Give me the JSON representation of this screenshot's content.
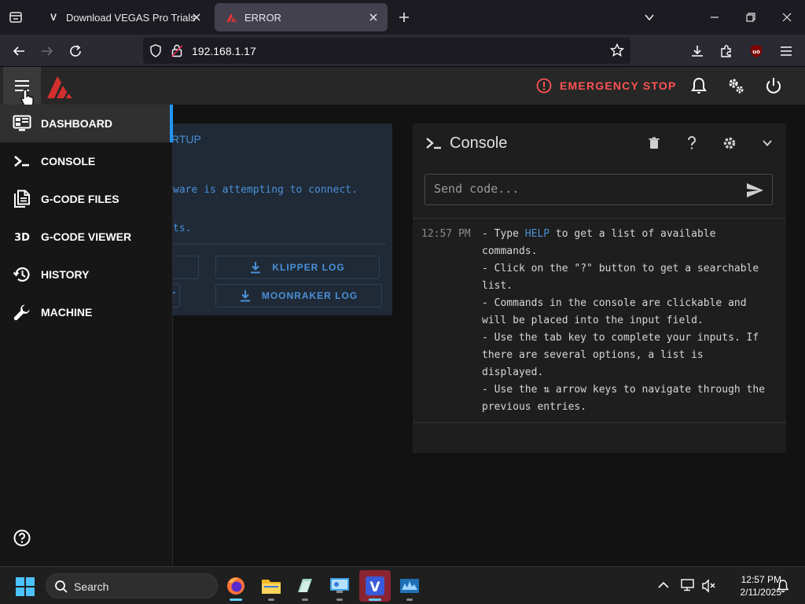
{
  "browser": {
    "tabs": [
      {
        "title": "Download VEGAS Pro Trials for",
        "favicon": "V"
      },
      {
        "title": "ERROR",
        "favicon": "mainsail-logo"
      }
    ],
    "url": "192.168.1.17"
  },
  "app": {
    "emergency_stop": "EMERGENCY STOP",
    "accent_color": "#ff5252"
  },
  "sidebar": {
    "items": [
      {
        "label": "DASHBOARD",
        "icon": "monitor-dashboard-icon"
      },
      {
        "label": "CONSOLE",
        "icon": "console-icon"
      },
      {
        "label": "G-CODE FILES",
        "icon": "files-icon"
      },
      {
        "label": "G-CODE VIEWER",
        "icon": "3d-icon"
      },
      {
        "label": "HISTORY",
        "icon": "history-icon"
      },
      {
        "label": "MACHINE",
        "icon": "wrench-icon"
      }
    ]
  },
  "startup": {
    "header": "RTUP",
    "message": "ware is attempting to connect.",
    "message2": "ts.",
    "klipper_log": "KLIPPER LOG",
    "moonraker_log": "MOONRAKER LOG",
    "left_btn2": "T"
  },
  "console": {
    "title": "Console",
    "input_placeholder": "Send code...",
    "entry_time": "12:57 PM",
    "lines": [
      {
        "pre": "- Type ",
        "kw": "HELP",
        "post": " to get a list of available"
      },
      {
        "pre": "commands.",
        "kw": "",
        "post": ""
      },
      {
        "pre": "- Click on the \"?\" button to get a searchable",
        "kw": "",
        "post": ""
      },
      {
        "pre": "list.",
        "kw": "",
        "post": ""
      },
      {
        "pre": "- Commands in the console are clickable and",
        "kw": "",
        "post": ""
      },
      {
        "pre": "will be placed into the input field.",
        "kw": "",
        "post": ""
      },
      {
        "pre": "- Use the tab key to complete your inputs. If",
        "kw": "",
        "post": ""
      },
      {
        "pre": "there are several options, a list is",
        "kw": "",
        "post": ""
      },
      {
        "pre": "displayed.",
        "kw": "",
        "post": ""
      },
      {
        "pre": "- Use the ⇅ arrow keys to navigate through the",
        "kw": "",
        "post": ""
      },
      {
        "pre": "previous entries.",
        "kw": "",
        "post": ""
      }
    ]
  },
  "taskbar": {
    "search_label": "Search",
    "time": "12:57 PM",
    "date": "2/11/2025"
  }
}
